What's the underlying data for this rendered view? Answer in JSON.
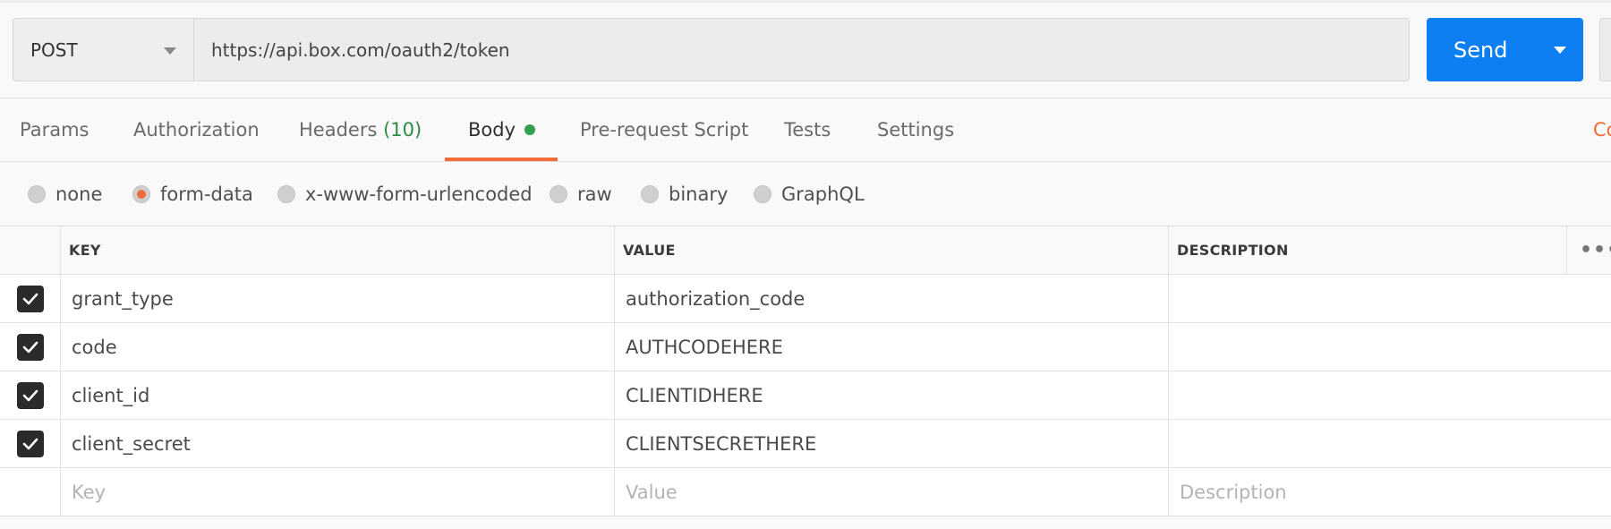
{
  "request": {
    "method": "POST",
    "url": "https://api.box.com/oauth2/token",
    "send_label": "Send"
  },
  "tabs": [
    {
      "label": "Params"
    },
    {
      "label": "Authorization"
    },
    {
      "label": "Headers",
      "count": "(10)"
    },
    {
      "label": "Body",
      "active": true
    },
    {
      "label": "Pre-request Script"
    },
    {
      "label": "Tests"
    },
    {
      "label": "Settings"
    }
  ],
  "cookies_label": "Co",
  "body_types": [
    {
      "label": "none",
      "selected": false
    },
    {
      "label": "form-data",
      "selected": true
    },
    {
      "label": "x-www-form-urlencoded",
      "selected": false
    },
    {
      "label": "raw",
      "selected": false
    },
    {
      "label": "binary",
      "selected": false
    },
    {
      "label": "GraphQL",
      "selected": false
    }
  ],
  "table": {
    "headers": {
      "key": "KEY",
      "value": "VALUE",
      "description": "DESCRIPTION",
      "more": "•••"
    },
    "rows": [
      {
        "checked": true,
        "key": "grant_type",
        "value": "authorization_code",
        "description": ""
      },
      {
        "checked": true,
        "key": "code",
        "value": "AUTHCODEHERE",
        "description": ""
      },
      {
        "checked": true,
        "key": "client_id",
        "value": "CLIENTIDHERE",
        "description": ""
      },
      {
        "checked": true,
        "key": "client_secret",
        "value": "CLIENTSECRETHERE",
        "description": ""
      }
    ],
    "placeholders": {
      "key": "Key",
      "value": "Value",
      "description": "Description"
    }
  },
  "colors": {
    "accent": "#f26b3a",
    "send_button": "#0e7ff2",
    "body_dot": "#2f9e4f",
    "headers_count": "#2e8b46"
  }
}
